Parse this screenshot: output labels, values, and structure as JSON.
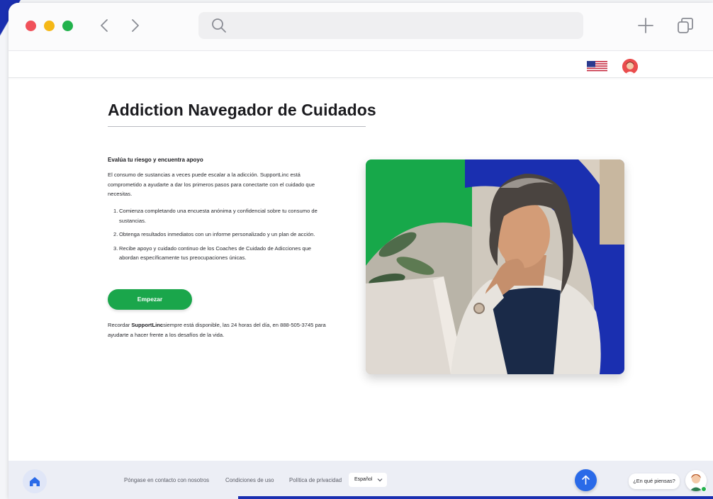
{
  "page": {
    "title": "Addiction Navegador de Cuidados",
    "subhead": "Evalúa tu riesgo y encuentra apoyo",
    "intro": "El consumo de sustancias a veces puede escalar a la adicción. SupportLinc está comprometido a ayudarte a dar los primeros pasos para conectarte con el cuidado que necesitas.",
    "steps": [
      {
        "num": "1.",
        "text": "Comienza completando una encuesta anónima y confidencial sobre tu consumo de sustancias."
      },
      {
        "num": "2.",
        "text": "Obtenga resultados inmediatos con un informe personalizado y un plan de acción."
      },
      {
        "num": "3.",
        "text": "Recibe apoyo y cuidado continuo de los Coaches de Cuidado de Adicciones que abordan específicamente tus preocupaciones únicas."
      }
    ],
    "start_button": "Empezar",
    "reminder_prefix": "Recordar ",
    "reminder_brand": "SupportLinc",
    "reminder_suffix": "siempre está disponible, las 24 horas del día, en 888-505-3745 para ayudarte a hacer frente a los desafíos de la vida."
  },
  "browser": {
    "search_placeholder": ""
  },
  "footer": {
    "contact": "Póngase en contacto con nosotros",
    "terms": "Condiciones de uso",
    "privacy": "Política de privacidad",
    "language": "Español",
    "chat_prompt": "¿En qué piensas?"
  },
  "colors": {
    "brand_blue": "#1a2fb0",
    "button_green": "#1aa64b",
    "up_button": "#2a6ae8"
  },
  "icons": [
    "search-icon",
    "back-arrow-icon",
    "forward-arrow-icon",
    "plus-icon",
    "tabs-icon",
    "us-flag-icon",
    "user-avatar-icon",
    "home-icon",
    "arrow-up-icon",
    "chevron-down-icon",
    "chat-agent-avatar"
  ]
}
